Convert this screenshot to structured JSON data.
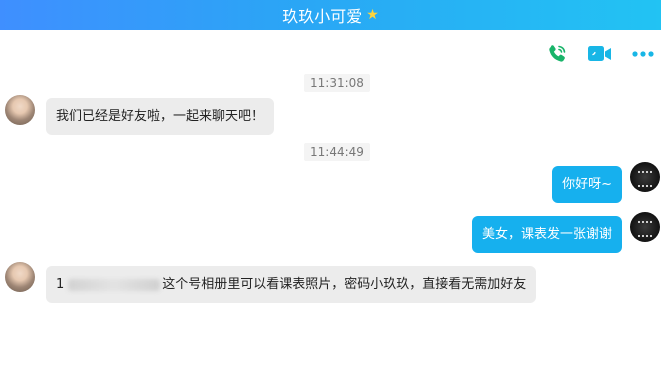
{
  "window": {
    "title": "玖玖小可爱"
  },
  "toolbar": {
    "icons": [
      "phone-call-icon",
      "video-call-icon",
      "more-icon"
    ],
    "accent": "#18b6e6"
  },
  "messages": [
    {
      "type": "time",
      "text": "11:31:08"
    },
    {
      "type": "msg",
      "side": "left",
      "text": "我们已经是好友啦，一起来聊天吧！"
    },
    {
      "type": "time",
      "text": "11:44:49"
    },
    {
      "type": "msg",
      "side": "right",
      "text": "你好呀~"
    },
    {
      "type": "msg",
      "side": "right",
      "text": "美女，课表发一张谢谢"
    },
    {
      "type": "msg",
      "side": "left",
      "prefix": "1",
      "text": "这个号相册里可以看课表照片，密码小玖玖，直接看无需加好友"
    }
  ],
  "colors": {
    "outgoing_bubble": "#16b0ee",
    "incoming_bubble": "#ececec",
    "titlebar": "#2aa6f5"
  }
}
